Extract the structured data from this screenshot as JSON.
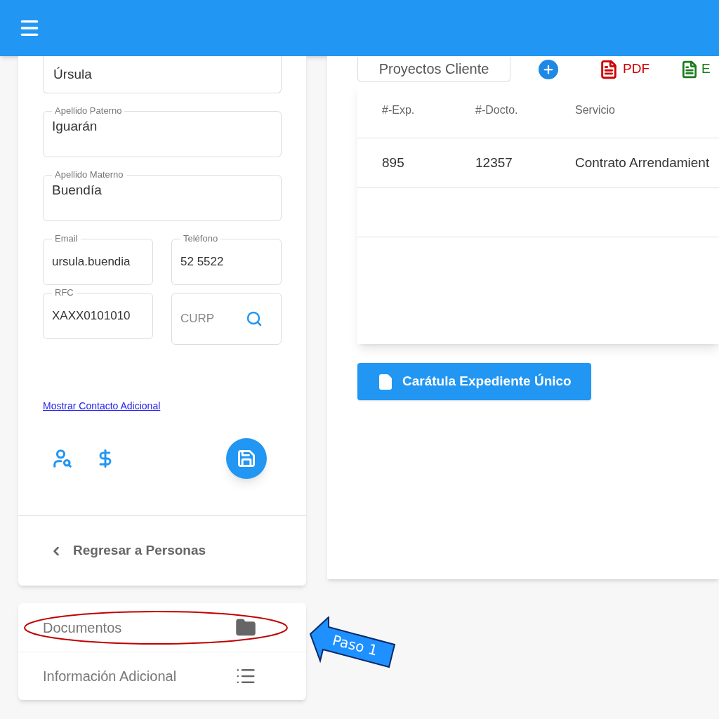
{
  "person_form": {
    "fields": [
      {
        "value": "Úrsula"
      },
      {
        "label": "Apellido Paterno",
        "value": "Iguarán"
      },
      {
        "label": "Apellido Materno",
        "value": "Buendía"
      }
    ],
    "pair_fields": [
      {
        "label": "Email",
        "value": "ursula.buendia"
      },
      {
        "label": "Teléfono",
        "value": "52 5522"
      },
      {
        "label": "RFC",
        "value": "XAXX0101010"
      },
      {
        "placeholder": "CURP",
        "kind": "search"
      }
    ],
    "link": "Mostrar Contacto Adicional",
    "back": "Regresar a Personas"
  },
  "menu": [
    {
      "label": "Documentos",
      "kind": "folder",
      "highlighted": true
    },
    {
      "label": "Información Adicional",
      "kind": "list",
      "highlighted": false
    }
  ],
  "toolbar": {
    "tab": "Proyectos Cliente",
    "pdf": "PDF",
    "excel": "E"
  },
  "table": {
    "columns": [
      "#-Exp.",
      "#-Docto.",
      "Servicio"
    ],
    "rows": [
      [
        "895",
        "12357",
        "Contrato Arrendamient"
      ]
    ]
  },
  "cover_button": "Carátula Expediente Único",
  "callout": "Paso 1"
}
